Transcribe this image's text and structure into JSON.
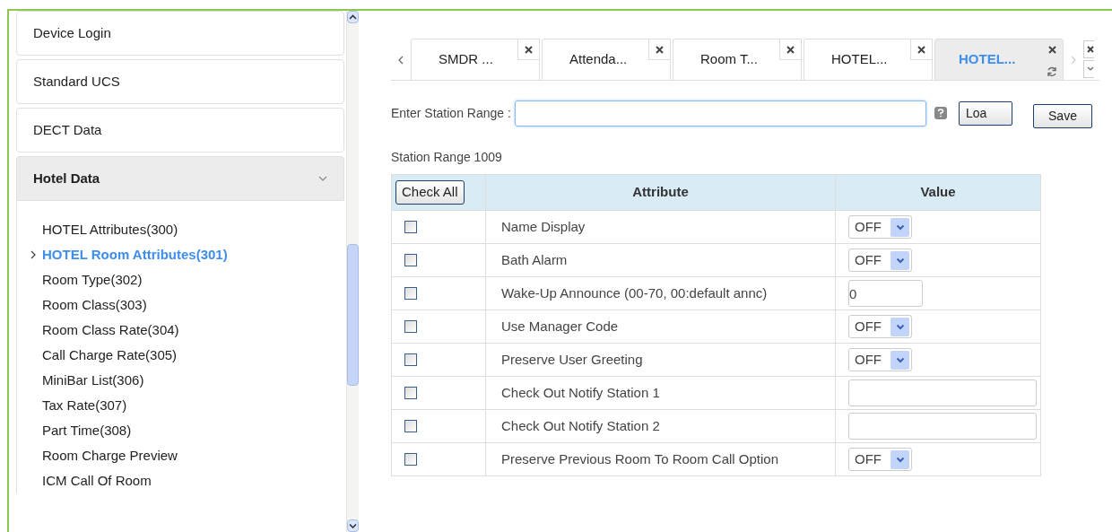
{
  "sidebar": {
    "items": [
      {
        "label": "Device Login",
        "expanded": false
      },
      {
        "label": "Standard UCS",
        "expanded": false
      },
      {
        "label": "DECT Data",
        "expanded": false
      },
      {
        "label": "Hotel Data",
        "expanded": true,
        "children": [
          {
            "label": "HOTEL Attributes(300)",
            "selected": false
          },
          {
            "label": "HOTEL Room Attributes(301)",
            "selected": true
          },
          {
            "label": "Room Type(302)",
            "selected": false
          },
          {
            "label": "Room Class(303)",
            "selected": false
          },
          {
            "label": "Room Class Rate(304)",
            "selected": false
          },
          {
            "label": "Call Charge Rate(305)",
            "selected": false
          },
          {
            "label": "MiniBar List(306)",
            "selected": false
          },
          {
            "label": "Tax Rate(307)",
            "selected": false
          },
          {
            "label": "Part Time(308)",
            "selected": false
          },
          {
            "label": "Room Charge Preview",
            "selected": false
          },
          {
            "label": "ICM Call Of Room",
            "selected": false
          }
        ]
      }
    ]
  },
  "tabs": [
    {
      "label": "SMDR ...",
      "selected": false
    },
    {
      "label": "Attenda...",
      "selected": false
    },
    {
      "label": "Room T...",
      "selected": false
    },
    {
      "label": "HOTEL...",
      "selected": false
    },
    {
      "label": "HOTEL...",
      "selected": true
    }
  ],
  "station_range": {
    "label": "Enter Station Range :",
    "load_button": "Loa",
    "save_button": "Save"
  },
  "range_caption": "Station Range 1009",
  "table": {
    "check_all": "Check All",
    "columns": [
      "Attribute",
      "Value"
    ],
    "rows": [
      {
        "attribute": "Name Display",
        "kind": "select",
        "value": "OFF",
        "checked": false
      },
      {
        "attribute": "Bath Alarm",
        "kind": "select",
        "value": "OFF",
        "checked": false
      },
      {
        "attribute": "Wake-Up Announce (00-70, 00:default annc)",
        "kind": "short-text",
        "value": "0",
        "checked": false
      },
      {
        "attribute": "Use Manager Code",
        "kind": "select",
        "value": "OFF",
        "checked": false
      },
      {
        "attribute": "Preserve User Greeting",
        "kind": "select",
        "value": "OFF",
        "checked": false
      },
      {
        "attribute": "Check Out Notify Station 1",
        "kind": "text",
        "checked": false
      },
      {
        "attribute": "Check Out Notify Station 2",
        "kind": "text",
        "checked": false
      },
      {
        "attribute": "Preserve Previous Room To Room Call Option",
        "kind": "select",
        "value": "OFF",
        "checked": false
      }
    ]
  }
}
